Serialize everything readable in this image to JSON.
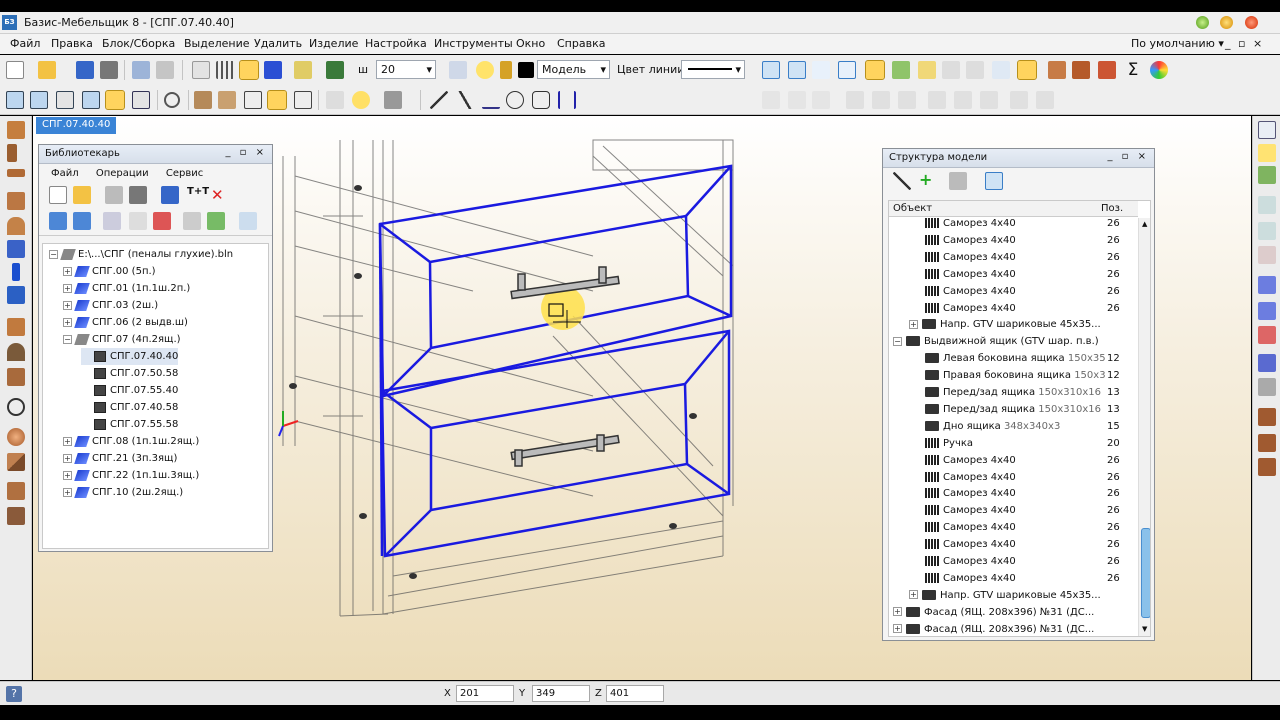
{
  "window": {
    "title": "Базис-Мебельщик 8 - [СПГ.07.40.40]",
    "app_icon": "БЗ"
  },
  "menu": [
    "Файл",
    "Правка",
    "Блок/Сборка",
    "Выделение",
    "Удалить",
    "Изделие",
    "Настройка",
    "Инструменты",
    "Окно",
    "Справка"
  ],
  "menu_right": {
    "preset": "По умолчанию",
    "controls": "_ ▫ ×"
  },
  "toolbar": {
    "step_label": "ш",
    "step_value": "20",
    "layer_value": "Модель",
    "line_color_label": "Цвет линии"
  },
  "document_tab": "СПГ.07.40.40",
  "librarian": {
    "title": "Библиотекарь",
    "menu": [
      "Файл",
      "Операции",
      "Сервис"
    ],
    "items": [
      {
        "label": "E:\\...\\СПГ (пеналы глухие).bln",
        "exp": "⊟",
        "level": 0,
        "icon": "folder"
      },
      {
        "label": "СПГ.00 (5п.)",
        "exp": "+",
        "level": 1,
        "icon": "blue"
      },
      {
        "label": "СПГ.01 (1п.1ш.2п.)",
        "exp": "+",
        "level": 1,
        "icon": "blue"
      },
      {
        "label": "СПГ.03 (2ш.)",
        "exp": "+",
        "level": 1,
        "icon": "blue"
      },
      {
        "label": "СПГ.06 (2 выдв.ш)",
        "exp": "+",
        "level": 1,
        "icon": "blue"
      },
      {
        "label": "СПГ.07 (4п.2ящ.)",
        "exp": "−",
        "level": 1,
        "icon": "gray"
      },
      {
        "label": "СПГ.07.40.40",
        "exp": "",
        "level": 2,
        "icon": "doc",
        "selected": true
      },
      {
        "label": "СПГ.07.50.58",
        "exp": "",
        "level": 2,
        "icon": "doc"
      },
      {
        "label": "СПГ.07.55.40",
        "exp": "",
        "level": 2,
        "icon": "doc"
      },
      {
        "label": "СПГ.07.40.58",
        "exp": "",
        "level": 2,
        "icon": "doc"
      },
      {
        "label": "СПГ.07.55.58",
        "exp": "",
        "level": 2,
        "icon": "doc"
      },
      {
        "label": "СПГ.08 (1п.1ш.2ящ.)",
        "exp": "+",
        "level": 1,
        "icon": "blue"
      },
      {
        "label": "СПГ.21 (3п.3ящ)",
        "exp": "+",
        "level": 1,
        "icon": "blue"
      },
      {
        "label": "СПГ.22 (1п.1ш.3ящ.)",
        "exp": "+",
        "level": 1,
        "icon": "blue"
      },
      {
        "label": "СПГ.10 (2ш.2ящ.)",
        "exp": "+",
        "level": 1,
        "icon": "blue"
      }
    ]
  },
  "structure": {
    "title": "Структура модели",
    "col_object": "Объект",
    "col_pos": "Поз.",
    "rows": [
      {
        "name": "Саморез 4х40",
        "dims": "",
        "pos": "26",
        "level": 2,
        "icon": "screw"
      },
      {
        "name": "Саморез 4х40",
        "dims": "",
        "pos": "26",
        "level": 2,
        "icon": "screw"
      },
      {
        "name": "Саморез 4х40",
        "dims": "",
        "pos": "26",
        "level": 2,
        "icon": "screw"
      },
      {
        "name": "Саморез 4х40",
        "dims": "",
        "pos": "26",
        "level": 2,
        "icon": "screw"
      },
      {
        "name": "Саморез 4х40",
        "dims": "",
        "pos": "26",
        "level": 2,
        "icon": "screw"
      },
      {
        "name": "Саморез 4х40",
        "dims": "",
        "pos": "26",
        "level": 2,
        "icon": "screw"
      },
      {
        "name": "Напр. GTV шариковые 45х35...",
        "dims": "",
        "pos": "",
        "level": 1,
        "icon": "rail",
        "exp": "+"
      },
      {
        "name": "Выдвижной ящик (GTV шар. п.в.)",
        "dims": "",
        "pos": "",
        "level": 0,
        "icon": "slab",
        "exp": "−"
      },
      {
        "name": "Левая боковина ящика",
        "dims": "150х35",
        "pos": "12",
        "level": 2,
        "icon": "slab"
      },
      {
        "name": "Правая боковина ящика",
        "dims": "150х3",
        "pos": "12",
        "level": 2,
        "icon": "slab"
      },
      {
        "name": "Перед/зад ящика",
        "dims": "150х310х16",
        "pos": "13",
        "level": 2,
        "icon": "slab"
      },
      {
        "name": "Перед/зад ящика",
        "dims": "150х310х16",
        "pos": "13",
        "level": 2,
        "icon": "slab"
      },
      {
        "name": "Дно ящика",
        "dims": "348х340х3",
        "pos": "15",
        "level": 2,
        "icon": "slab"
      },
      {
        "name": "Ручка",
        "dims": "",
        "pos": "20",
        "level": 2,
        "icon": "screw"
      },
      {
        "name": "Саморез 4х40",
        "dims": "",
        "pos": "26",
        "level": 2,
        "icon": "screw"
      },
      {
        "name": "Саморез 4х40",
        "dims": "",
        "pos": "26",
        "level": 2,
        "icon": "screw"
      },
      {
        "name": "Саморез 4х40",
        "dims": "",
        "pos": "26",
        "level": 2,
        "icon": "screw"
      },
      {
        "name": "Саморез 4х40",
        "dims": "",
        "pos": "26",
        "level": 2,
        "icon": "screw"
      },
      {
        "name": "Саморез 4х40",
        "dims": "",
        "pos": "26",
        "level": 2,
        "icon": "screw"
      },
      {
        "name": "Саморез 4х40",
        "dims": "",
        "pos": "26",
        "level": 2,
        "icon": "screw"
      },
      {
        "name": "Саморез 4х40",
        "dims": "",
        "pos": "26",
        "level": 2,
        "icon": "screw"
      },
      {
        "name": "Саморез 4х40",
        "dims": "",
        "pos": "26",
        "level": 2,
        "icon": "screw"
      },
      {
        "name": "Напр. GTV шариковые 45х35...",
        "dims": "",
        "pos": "",
        "level": 1,
        "icon": "rail",
        "exp": "+"
      },
      {
        "name": "Фасад (ЯЩ. 208х396) №31 (ДС...",
        "dims": "",
        "pos": "",
        "level": 0,
        "icon": "slab",
        "exp": "+"
      },
      {
        "name": "Фасад (ЯЩ. 208х396) №31 (ДС...",
        "dims": "",
        "pos": "",
        "level": 0,
        "icon": "slab",
        "exp": "+"
      }
    ]
  },
  "status": {
    "help": "?",
    "x_label": "X",
    "x_value": "201",
    "y_label": "Y",
    "y_value": "349",
    "z_label": "Z",
    "z_value": "401"
  },
  "colors": {
    "accent": "#3a84d6",
    "selection": "#1a1ae0",
    "highlight": "#ffe14a"
  }
}
